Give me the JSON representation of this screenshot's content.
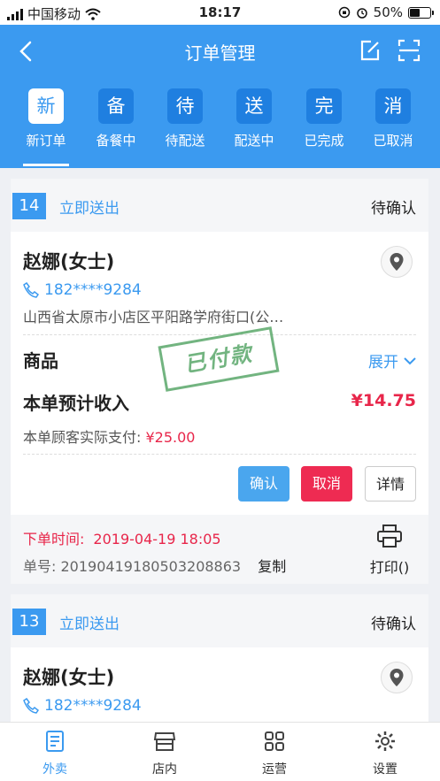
{
  "status_bar": {
    "carrier": "中国移动",
    "time": "18:17",
    "battery": "50%"
  },
  "nav": {
    "title": "订单管理"
  },
  "tabs": [
    {
      "glyph": "新",
      "label": "新订单",
      "active": true
    },
    {
      "glyph": "备",
      "label": "备餐中"
    },
    {
      "glyph": "待",
      "label": "待配送"
    },
    {
      "glyph": "送",
      "label": "配送中"
    },
    {
      "glyph": "完",
      "label": "已完成"
    },
    {
      "glyph": "消",
      "label": "已取消"
    }
  ],
  "orders": [
    {
      "number": "14",
      "delivery": "立即送出",
      "status": "待确认",
      "customer": "赵娜(女士)",
      "phone": "182****9284",
      "address": "山西省太原市小店区平阳路学府街口(公…",
      "goods_label": "商品",
      "expand_label": "展开",
      "stamp": "已付款",
      "income_label": "本单预计收入",
      "income_value": "¥14.75",
      "paid_label": "本单顾客实际支付:",
      "paid_value": "¥25.00",
      "btn_confirm": "确认",
      "btn_cancel": "取消",
      "btn_detail": "详情",
      "order_time_label": "下单时间:",
      "order_time": "2019-04-19 18:05",
      "order_no_label": "单号:",
      "order_no": "20190419180503208863",
      "copy_label": "复制",
      "print_label": "打印()"
    },
    {
      "number": "13",
      "delivery": "立即送出",
      "status": "待确认",
      "customer": "赵娜(女士)",
      "phone": "182****9284"
    }
  ],
  "tabbar": [
    {
      "label": "外卖",
      "icon": "document-icon",
      "active": true
    },
    {
      "label": "店内",
      "icon": "store-icon"
    },
    {
      "label": "运营",
      "icon": "grid-icon"
    },
    {
      "label": "设置",
      "icon": "gear-icon"
    }
  ],
  "colors": {
    "primary": "#3b9af0",
    "danger": "#e8264a",
    "stamp": "#5aa86a"
  }
}
